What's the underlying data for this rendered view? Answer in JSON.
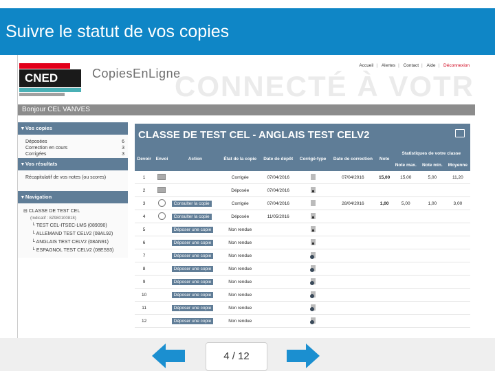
{
  "slide": {
    "title": "Suivre le statut de vos copies",
    "page_indicator": "4 / 12"
  },
  "site": {
    "logo_text": "CNED",
    "brand": "CopiesEnLigne",
    "watermark": "CONNECTÉ À VOTR",
    "top_links": [
      "Accueil",
      "Alertes",
      "Contact",
      "Aide"
    ],
    "logout_label": "Déconnexion"
  },
  "welcome": "Bonjour CEL VANVES",
  "sidebar": {
    "copies": {
      "title": "Vos copies",
      "items": [
        {
          "label": "Déposées",
          "count": "6"
        },
        {
          "label": "Correction en cours",
          "count": "3"
        },
        {
          "label": "Corrigées",
          "count": "3"
        }
      ]
    },
    "results": {
      "title": "Vos résultats",
      "item": "Récapitulatif de vos notes (ou scores)"
    },
    "navigation": {
      "title": "Navigation",
      "root": "CLASSE DE TEST CEL",
      "indicatif": "(Indicatif : 8Z980100818)",
      "children": [
        "TEST CEL-ITSEC-LMS (089090)",
        "ALLEMAND TEST CELV2 (08AL92)",
        "ANGLAIS TEST CELV2 (08AN91)",
        "ESPAGNOL TEST CELV2 (08ES93)"
      ]
    }
  },
  "main": {
    "title": "CLASSE DE TEST CEL - ANGLAIS TEST CELV2",
    "headers": {
      "devoir": "Devoir",
      "envoi": "Envoi",
      "action": "Action",
      "etat": "État de la copie",
      "date_depot": "Date de dépôt",
      "corrige_type": "Corrigé-type",
      "date_correction": "Date de correction",
      "note": "Note",
      "stats": "Statistiques de votre classe",
      "note_max": "Note max.",
      "note_min": "Note min.",
      "moyenne": "Moyenne"
    },
    "rows": [
      {
        "devoir": "1",
        "envoi": "mail",
        "action": "",
        "etat": "Corrigée",
        "etat_type": "green",
        "date_depot": "07/04/2016",
        "corrige": "doc",
        "date_correction": "07/04/2016",
        "note": "15,00",
        "max": "15,00",
        "min": "5,00",
        "moy": "11,20"
      },
      {
        "devoir": "2",
        "envoi": "mail",
        "action": "",
        "etat": "Déposée",
        "etat_type": "normal",
        "date_depot": "07/04/2016",
        "corrige": "lock",
        "date_correction": "",
        "note": "",
        "max": "",
        "min": "",
        "moy": ""
      },
      {
        "devoir": "3",
        "envoi": "globe",
        "action": "Consulter la copie",
        "etat": "Corrigée",
        "etat_type": "green",
        "date_depot": "07/04/2016",
        "corrige": "doc",
        "date_correction": "28/04/2016",
        "note": "1,00",
        "max": "5,00",
        "min": "1,00",
        "moy": "3,00"
      },
      {
        "devoir": "4",
        "envoi": "globe",
        "action": "Consulter la copie",
        "etat": "Déposée",
        "etat_type": "normal",
        "date_depot": "11/05/2016",
        "corrige": "lock",
        "date_correction": "",
        "note": "",
        "max": "",
        "min": "",
        "moy": ""
      },
      {
        "devoir": "5",
        "envoi": "",
        "action": "Déposer une copie",
        "etat": "Non rendue",
        "etat_type": "red",
        "date_depot": "",
        "corrige": "lock",
        "date_correction": "",
        "note": "",
        "max": "",
        "min": "",
        "moy": ""
      },
      {
        "devoir": "6",
        "envoi": "",
        "action": "Déposer une copie",
        "etat": "Non rendue",
        "etat_type": "red",
        "date_depot": "",
        "corrige": "lock",
        "date_correction": "",
        "note": "",
        "max": "",
        "min": "",
        "moy": ""
      },
      {
        "devoir": "7",
        "envoi": "",
        "action": "Déposer une copie",
        "etat": "Non rendue",
        "etat_type": "red",
        "date_depot": "",
        "corrige": "noentry",
        "date_correction": "",
        "note": "",
        "max": "",
        "min": "",
        "moy": ""
      },
      {
        "devoir": "8",
        "envoi": "",
        "action": "Déposer une copie",
        "etat": "Non rendue",
        "etat_type": "red",
        "date_depot": "",
        "corrige": "noentry",
        "date_correction": "",
        "note": "",
        "max": "",
        "min": "",
        "moy": ""
      },
      {
        "devoir": "9",
        "envoi": "",
        "action": "Déposer une copie",
        "etat": "Non rendue",
        "etat_type": "red",
        "date_depot": "",
        "corrige": "noentry",
        "date_correction": "",
        "note": "",
        "max": "",
        "min": "",
        "moy": ""
      },
      {
        "devoir": "10",
        "envoi": "",
        "action": "Déposer une copie",
        "etat": "Non rendue",
        "etat_type": "red",
        "date_depot": "",
        "corrige": "noentry",
        "date_correction": "",
        "note": "",
        "max": "",
        "min": "",
        "moy": ""
      },
      {
        "devoir": "11",
        "envoi": "",
        "action": "Déposer une copie",
        "etat": "Non rendue",
        "etat_type": "red",
        "date_depot": "",
        "corrige": "noentry",
        "date_correction": "",
        "note": "",
        "max": "",
        "min": "",
        "moy": ""
      },
      {
        "devoir": "12",
        "envoi": "",
        "action": "Déposer une copie",
        "etat": "Non rendue",
        "etat_type": "red",
        "date_depot": "",
        "corrige": "noentry",
        "date_correction": "",
        "note": "",
        "max": "",
        "min": "",
        "moy": ""
      }
    ]
  },
  "colors": {
    "header_blue": "#0f86c6",
    "table_header": "#5f7d97",
    "arrow_blue": "#1b8fd0",
    "status_green": "#2e8b2e",
    "status_red": "#cc1111"
  }
}
